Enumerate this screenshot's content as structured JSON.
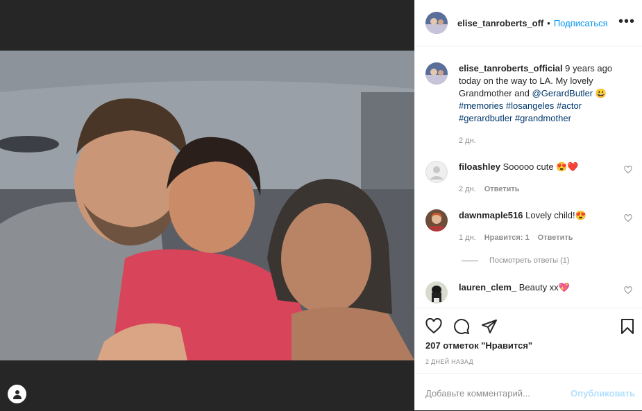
{
  "header": {
    "username": "elise_tanroberts_off",
    "separator": "•",
    "follow_label": "Подписаться",
    "more_label": "•••"
  },
  "caption": {
    "username": "elise_tanroberts_official",
    "text_before": " 9 years ago today on the way to LA. My lovely Grandmother and ",
    "mention": "@GerardButler",
    "emoji": " 😃",
    "hashtags": [
      "#memories",
      "#losangeles",
      "#actor",
      "#gerardbutler",
      "#grandmother"
    ],
    "time": "2 дн."
  },
  "comments": [
    {
      "username": "filoashley",
      "text": " Sooooo cute 😍❤️",
      "time": "2 дн.",
      "likes": "",
      "reply_label": "Ответить"
    },
    {
      "username": "dawnmaple516",
      "text": " Lovely child!😍",
      "time": "1 дн.",
      "likes": "Нравится: 1",
      "reply_label": "Ответить"
    },
    {
      "username": "lauren_clem_",
      "text": " Beauty xx💖",
      "time": "",
      "likes": "",
      "reply_label": ""
    }
  ],
  "view_replies": "Посмотреть ответы (1)",
  "likes_text": "207 отметок \"Нравится\"",
  "date_text": "2 ДНЕЙ НАЗАД",
  "add_comment": {
    "placeholder": "Добавьте комментарий...",
    "publish_label": "Опубликовать"
  }
}
